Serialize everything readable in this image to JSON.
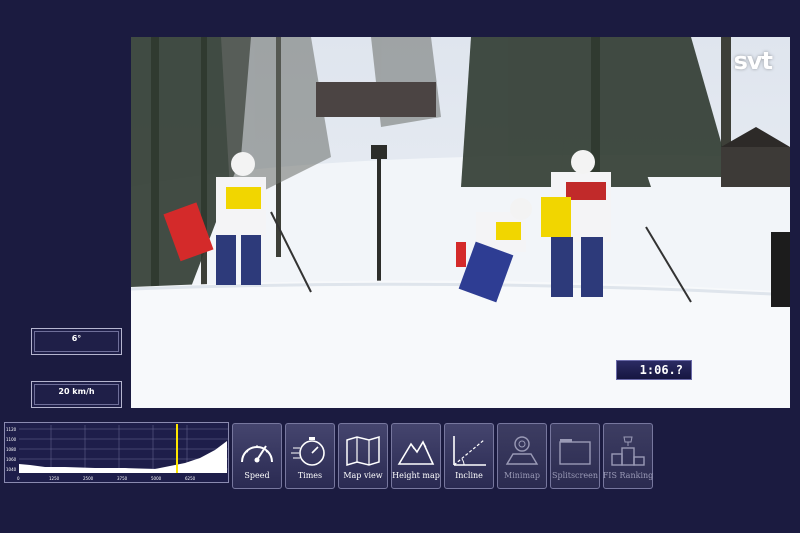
{
  "broadcaster": "svt",
  "race_timer": "1:06.?",
  "incline_readout": "6°",
  "speed_readout": "20 km/h",
  "profile_axis": {
    "y_labels": [
      "1120",
      "1100",
      "1080",
      "1060",
      "1040"
    ],
    "x_labels": [
      "0",
      "1250",
      "2500",
      "3750",
      "5000",
      "6250"
    ],
    "marker_position_fraction": 0.76
  },
  "toolbar": {
    "items": [
      {
        "label": "Speed",
        "icon": "speedometer-icon",
        "enabled": true
      },
      {
        "label": "Times",
        "icon": "stopwatch-icon",
        "enabled": true
      },
      {
        "label": "Map view",
        "icon": "map-icon",
        "enabled": true
      },
      {
        "label": "Height map",
        "icon": "mountain-icon",
        "enabled": true
      },
      {
        "label": "Incline",
        "icon": "incline-icon",
        "enabled": true
      },
      {
        "label": "Minimap",
        "icon": "minimap-icon",
        "enabled": false
      },
      {
        "label": "Splitscreen",
        "icon": "splitscreen-icon",
        "enabled": false
      },
      {
        "label": "FIS Ranking",
        "icon": "podium-icon",
        "enabled": false
      }
    ]
  },
  "colors": {
    "background": "#1b1b40",
    "profile_fill": "#ffffff",
    "marker": "#ffe600"
  }
}
